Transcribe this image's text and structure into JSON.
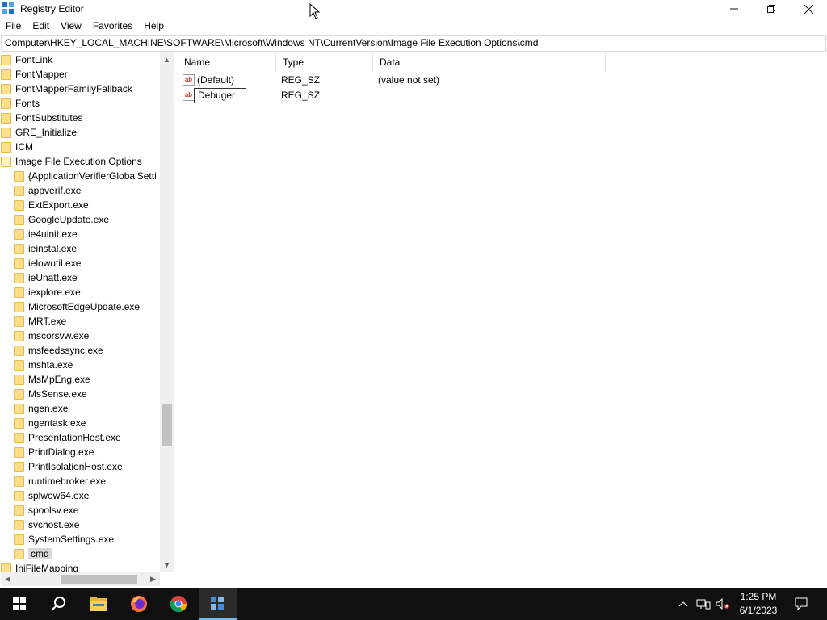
{
  "window": {
    "title": "Registry Editor",
    "controls": [
      "minimize",
      "restore",
      "close"
    ]
  },
  "menu": [
    "File",
    "Edit",
    "View",
    "Favorites",
    "Help"
  ],
  "address": "Computer\\HKEY_LOCAL_MACHINE\\SOFTWARE\\Microsoft\\Windows NT\\CurrentVersion\\Image File Execution Options\\cmd",
  "tree": {
    "items": [
      {
        "label": "FontLink",
        "level": 0
      },
      {
        "label": "FontMapper",
        "level": 0
      },
      {
        "label": "FontMapperFamilyFallback",
        "level": 0
      },
      {
        "label": "Fonts",
        "level": 0
      },
      {
        "label": "FontSubstitutes",
        "level": 0
      },
      {
        "label": "GRE_Initialize",
        "level": 0
      },
      {
        "label": "ICM",
        "level": 0
      },
      {
        "label": "Image File Execution Options",
        "level": 0
      },
      {
        "label": "{ApplicationVerifierGlobalSetti",
        "level": 1
      },
      {
        "label": "appverif.exe",
        "level": 1
      },
      {
        "label": "ExtExport.exe",
        "level": 1
      },
      {
        "label": "GoogleUpdate.exe",
        "level": 1
      },
      {
        "label": "ie4uinit.exe",
        "level": 1
      },
      {
        "label": "ieinstal.exe",
        "level": 1
      },
      {
        "label": "ielowutil.exe",
        "level": 1
      },
      {
        "label": "ieUnatt.exe",
        "level": 1
      },
      {
        "label": "iexplore.exe",
        "level": 1
      },
      {
        "label": "MicrosoftEdgeUpdate.exe",
        "level": 1
      },
      {
        "label": "MRT.exe",
        "level": 1
      },
      {
        "label": "mscorsvw.exe",
        "level": 1
      },
      {
        "label": "msfeedssync.exe",
        "level": 1
      },
      {
        "label": "mshta.exe",
        "level": 1
      },
      {
        "label": "MsMpEng.exe",
        "level": 1
      },
      {
        "label": "MsSense.exe",
        "level": 1
      },
      {
        "label": "ngen.exe",
        "level": 1
      },
      {
        "label": "ngentask.exe",
        "level": 1
      },
      {
        "label": "PresentationHost.exe",
        "level": 1
      },
      {
        "label": "PrintDialog.exe",
        "level": 1
      },
      {
        "label": "PrintIsolationHost.exe",
        "level": 1
      },
      {
        "label": "runtimebroker.exe",
        "level": 1
      },
      {
        "label": "splwow64.exe",
        "level": 1
      },
      {
        "label": "spoolsv.exe",
        "level": 1
      },
      {
        "label": "svchost.exe",
        "level": 1
      },
      {
        "label": "SystemSettings.exe",
        "level": 1
      },
      {
        "label": "cmd",
        "level": 1,
        "selected": true
      },
      {
        "label": "IniFileMapping",
        "level": 0
      }
    ]
  },
  "columns": {
    "name": "Name",
    "type": "Type",
    "data": "Data"
  },
  "values": [
    {
      "name": "(Default)",
      "type": "REG_SZ",
      "data": "(value not set)",
      "icon": "string-value-icon"
    },
    {
      "name": "Debuger",
      "type": "REG_SZ",
      "data": "",
      "icon": "string-value-icon",
      "editing": true
    }
  ],
  "taskbar": {
    "apps": [
      "start-button",
      "search-icon",
      "file-explorer-icon",
      "firefox-icon",
      "chrome-icon",
      "registry-editor-icon"
    ],
    "time": "1:25 PM",
    "date": "6/1/2023"
  }
}
